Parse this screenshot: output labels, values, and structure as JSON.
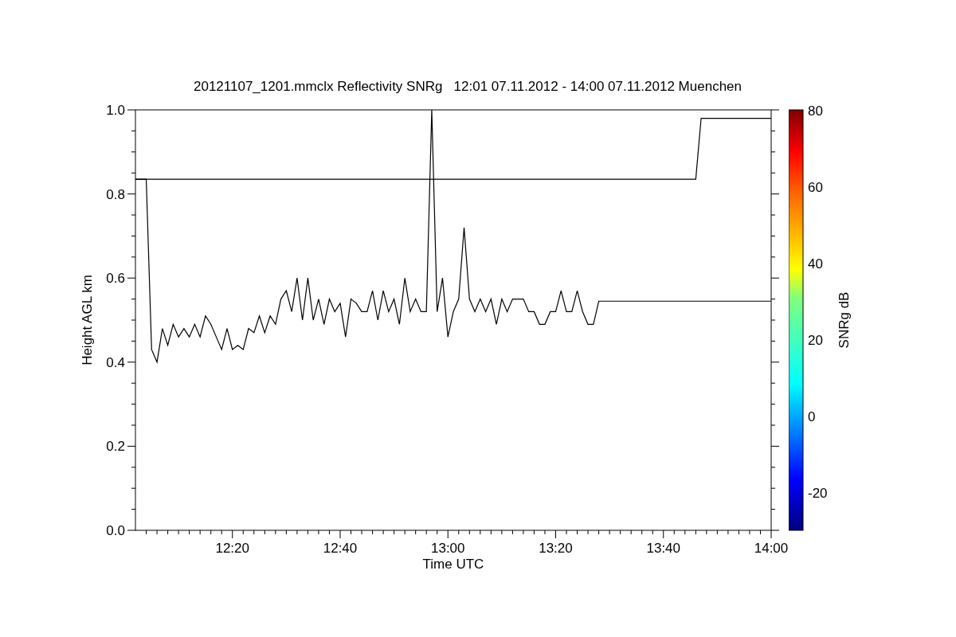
{
  "chart_data": {
    "type": "line",
    "title": "20121107_1201.mmclx Reflectivity SNRg   12:01 07.11.2012 - 14:00 07.11.2012 Muenchen",
    "xlabel": "Time UTC",
    "ylabel": "Height AGL km",
    "x": [
      12.0333,
      12.05,
      12.0667,
      12.0833,
      12.1,
      12.1167,
      12.1333,
      12.15,
      12.1667,
      12.1833,
      12.2,
      12.2167,
      12.2333,
      12.25,
      12.2667,
      12.2833,
      12.3,
      12.3167,
      12.3333,
      12.35,
      12.3667,
      12.3833,
      12.4,
      12.4167,
      12.4333,
      12.45,
      12.4667,
      12.4833,
      12.5,
      12.5167,
      12.5333,
      12.55,
      12.5667,
      12.5833,
      12.6,
      12.6167,
      12.6333,
      12.65,
      12.6667,
      12.6833,
      12.7,
      12.7167,
      12.7333,
      12.75,
      12.7667,
      12.7833,
      12.8,
      12.8167,
      12.8333,
      12.85,
      12.8667,
      12.8833,
      12.9,
      12.9167,
      12.9333,
      12.95,
      12.9667,
      12.9833,
      13,
      13.0167,
      13.0333,
      13.05,
      13.0667,
      13.0833,
      13.1,
      13.1167,
      13.1333,
      13.15,
      13.1667,
      13.1833,
      13.2,
      13.2167,
      13.2333,
      13.25,
      13.2667,
      13.2833,
      13.3,
      13.3167,
      13.3333,
      13.35,
      13.3667,
      13.3833,
      13.4,
      13.4167,
      13.4333,
      13.45,
      13.4667,
      13.4833,
      13.5,
      13.5167,
      13.5333,
      13.55,
      13.5667,
      13.5833,
      13.6,
      13.6167,
      13.6333,
      13.65,
      13.6667,
      13.6833,
      13.7,
      13.7167,
      13.7333,
      13.75,
      13.7667,
      13.7833,
      13.8,
      13.8167,
      13.8333,
      13.85,
      13.8667,
      13.8833,
      13.9,
      13.9167,
      13.9333,
      13.95,
      13.9667,
      13.9833,
      14
    ],
    "series": [
      {
        "color": "#000000",
        "values": [
          0.835,
          0.835,
          0.835,
          0.43,
          0.4,
          0.48,
          0.44,
          0.49,
          0.46,
          0.48,
          0.46,
          0.49,
          0.46,
          0.51,
          0.49,
          0.46,
          0.43,
          0.48,
          0.43,
          0.44,
          0.43,
          0.48,
          0.47,
          0.51,
          0.47,
          0.51,
          0.49,
          0.55,
          0.57,
          0.52,
          0.6,
          0.5,
          0.6,
          0.5,
          0.55,
          0.49,
          0.55,
          0.52,
          0.54,
          0.46,
          0.55,
          0.54,
          0.52,
          0.52,
          0.57,
          0.5,
          0.57,
          0.52,
          0.55,
          0.49,
          0.6,
          0.52,
          0.55,
          0.52,
          0.52,
          1.0,
          0.52,
          0.6,
          0.46,
          0.52,
          0.55,
          0.72,
          0.55,
          0.52,
          0.55,
          0.52,
          0.55,
          0.49,
          0.55,
          0.52,
          0.55,
          0.55,
          0.55,
          0.52,
          0.52,
          0.49,
          0.49,
          0.52,
          0.52,
          0.57,
          0.52,
          0.52,
          0.57,
          0.52,
          0.49,
          0.49,
          0.545,
          0.545,
          0.545,
          0.545,
          0.545,
          0.545,
          0.545,
          0.545,
          0.545,
          0.545,
          0.545,
          0.545,
          0.545,
          0.545,
          0.545,
          0.545,
          0.545,
          0.545,
          0.545,
          0.545,
          0.545,
          0.545,
          0.545,
          0.545,
          0.545,
          0.545,
          0.545,
          0.545,
          0.545,
          0.545,
          0.545,
          0.545,
          0.545
        ]
      },
      {
        "color": "#000000",
        "values": [
          0.835,
          0.835,
          0.835,
          0.835,
          0.835,
          0.835,
          0.835,
          0.835,
          0.835,
          0.835,
          0.835,
          0.835,
          0.835,
          0.835,
          0.835,
          0.835,
          0.835,
          0.835,
          0.835,
          0.835,
          0.835,
          0.835,
          0.835,
          0.835,
          0.835,
          0.835,
          0.835,
          0.835,
          0.835,
          0.835,
          0.835,
          0.835,
          0.835,
          0.835,
          0.835,
          0.835,
          0.835,
          0.835,
          0.835,
          0.835,
          0.835,
          0.835,
          0.835,
          0.835,
          0.835,
          0.835,
          0.835,
          0.835,
          0.835,
          0.835,
          0.835,
          0.835,
          0.835,
          0.835,
          0.835,
          0.835,
          0.835,
          0.835,
          0.835,
          0.835,
          0.835,
          0.835,
          0.835,
          0.835,
          0.835,
          0.835,
          0.835,
          0.835,
          0.835,
          0.835,
          0.835,
          0.835,
          0.835,
          0.835,
          0.835,
          0.835,
          0.835,
          0.835,
          0.835,
          0.835,
          0.835,
          0.835,
          0.835,
          0.835,
          0.835,
          0.835,
          0.835,
          0.835,
          0.835,
          0.835,
          0.835,
          0.835,
          0.835,
          0.835,
          0.835,
          0.835,
          0.835,
          0.835,
          0.835,
          0.835,
          0.835,
          0.835,
          0.835,
          0.835,
          0.835,
          0.98,
          0.98,
          0.98,
          0.98,
          0.98,
          0.98,
          0.98,
          0.98,
          0.98,
          0.98,
          0.98,
          0.98,
          0.98,
          0.98
        ]
      }
    ],
    "xlim": [
      12.0333,
      14
    ],
    "ylim": [
      0,
      1
    ],
    "xticks": [
      {
        "value": 12.3333,
        "label": "12:20"
      },
      {
        "value": 12.6667,
        "label": "12:40"
      },
      {
        "value": 13,
        "label": "13:00"
      },
      {
        "value": 13.3333,
        "label": "13:20"
      },
      {
        "value": 13.6667,
        "label": "13:40"
      },
      {
        "value": 14,
        "label": "14:00"
      }
    ],
    "yticks": [
      {
        "value": 0,
        "label": "0.0"
      },
      {
        "value": 0.2,
        "label": "0.2"
      },
      {
        "value": 0.4,
        "label": "0.4"
      },
      {
        "value": 0.6,
        "label": "0.6"
      },
      {
        "value": 0.8,
        "label": "0.8"
      },
      {
        "value": 1,
        "label": "1.0"
      }
    ]
  },
  "colorbar": {
    "label": "SNRg dB",
    "ticks": [
      "80",
      "60",
      "40",
      "20",
      "0",
      "-20"
    ]
  }
}
